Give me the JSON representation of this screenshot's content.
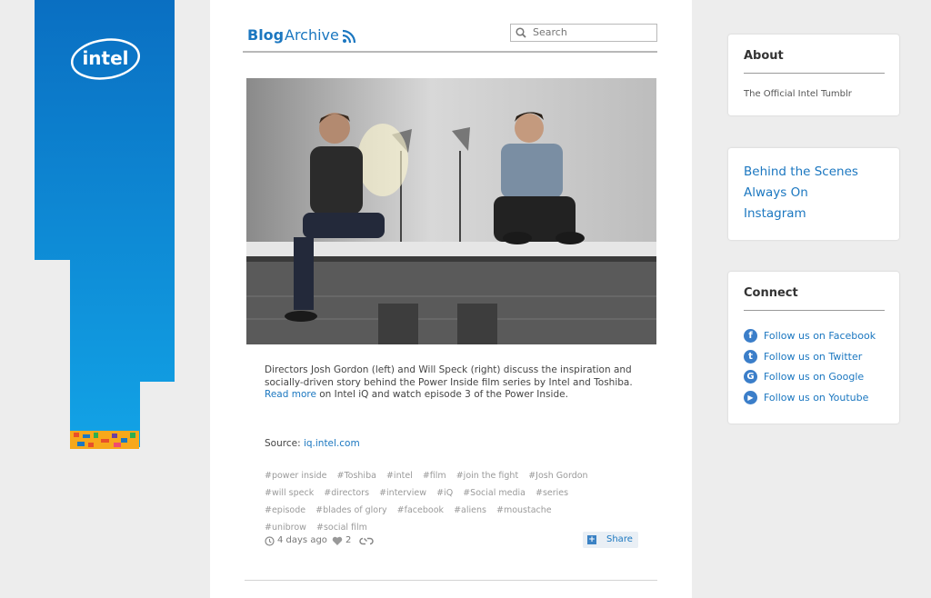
{
  "brand": {
    "logo_text": "intel"
  },
  "nav": {
    "blog": "Blog",
    "archive": "Archive",
    "rss_icon": "rss-icon"
  },
  "search": {
    "placeholder": "Search"
  },
  "post": {
    "caption_before": "Directors Josh Gordon (left) and Will Speck (right) discuss the inspiration and socially-driven story behind the Power Inside film series by Intel and Toshiba.",
    "read_more": "Read more",
    "caption_after": " on Intel iQ and watch episode 3 of the Power Inside.",
    "source_label": "Source: ",
    "source_link": "iq.intel.com",
    "tags": [
      "#power inside",
      "#Toshiba",
      "#intel",
      "#film",
      "#join the fight",
      "#Josh Gordon",
      "#will speck",
      "#directors",
      "#interview",
      "#iQ",
      "#Social media",
      "#series",
      "#episode",
      "#blades of glory",
      "#facebook",
      "#aliens",
      "#moustache",
      "#unibrow",
      "#social film"
    ],
    "time_ago": "4 days ago",
    "likes": "2",
    "share_label": "Share"
  },
  "sidebar": {
    "about": {
      "title": "About",
      "text": "The Official Intel Tumblr"
    },
    "links": [
      "Behind the Scenes",
      "Always On",
      "Instagram"
    ],
    "connect": {
      "title": "Connect",
      "items": [
        {
          "label": "Follow us on Facebook",
          "icon": "facebook-icon",
          "glyph": "f"
        },
        {
          "label": "Follow us on Twitter",
          "icon": "twitter-icon",
          "glyph": "t"
        },
        {
          "label": "Follow us on Google",
          "icon": "google-icon",
          "glyph": "G"
        },
        {
          "label": "Follow us on Youtube",
          "icon": "youtube-icon",
          "glyph": "▶"
        }
      ]
    }
  },
  "colors": {
    "accent": "#1b77c0",
    "strip_blue": "#0a8ad6",
    "background": "#ededed"
  }
}
